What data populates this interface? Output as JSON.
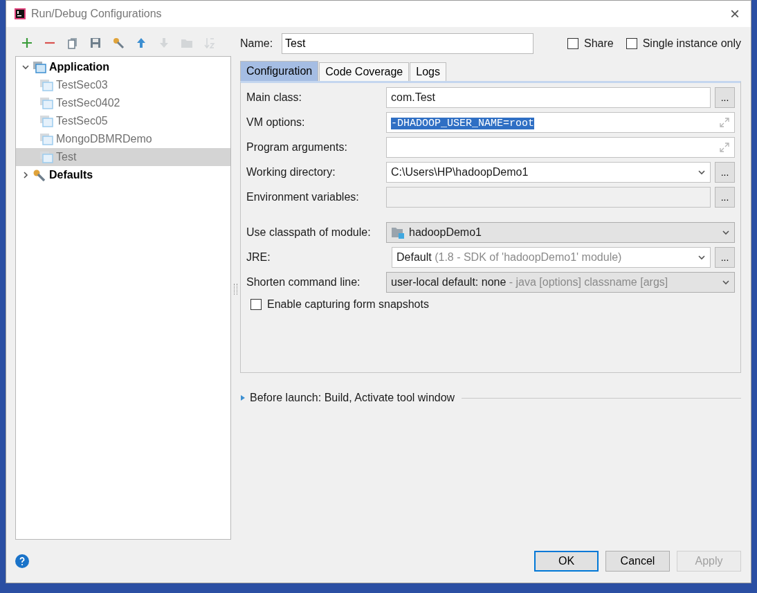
{
  "window": {
    "title": "Run/Debug Configurations",
    "close": "×"
  },
  "toolbar": [
    {
      "kind": "add",
      "disabled": false
    },
    {
      "kind": "remove",
      "disabled": false
    },
    {
      "kind": "copy",
      "disabled": false
    },
    {
      "kind": "save",
      "disabled": false
    },
    {
      "kind": "wrench",
      "disabled": false
    },
    {
      "kind": "up",
      "disabled": false
    },
    {
      "kind": "down",
      "disabled": true
    },
    {
      "kind": "folder",
      "disabled": true
    },
    {
      "kind": "sort",
      "disabled": true
    }
  ],
  "tree": [
    {
      "label": "Application",
      "kind": "group",
      "expanded": true,
      "selected": false,
      "children": [
        {
          "label": "TestSec03",
          "kind": "config",
          "selected": false
        },
        {
          "label": "TestSec0402",
          "kind": "config",
          "selected": false
        },
        {
          "label": "TestSec05",
          "kind": "config",
          "selected": false
        },
        {
          "label": "MongoDBMRDemo",
          "kind": "config",
          "selected": false
        },
        {
          "label": "Test",
          "kind": "config",
          "selected": true
        }
      ]
    },
    {
      "label": "Defaults",
      "kind": "defaults",
      "expanded": false,
      "selected": false
    }
  ],
  "name": {
    "label": "Name:",
    "value": "Test"
  },
  "options": [
    {
      "label": "Share",
      "checked": false
    },
    {
      "label": "Single instance only",
      "checked": false
    }
  ],
  "tabs": [
    {
      "label": "Configuration",
      "selected": true
    },
    {
      "label": "Code Coverage",
      "selected": false
    },
    {
      "label": "Logs",
      "selected": false
    }
  ],
  "fields": [
    {
      "kind": "text",
      "label": "Main class:",
      "value": "com.Test",
      "browse": "..."
    },
    {
      "kind": "expandable",
      "label": "VM options:",
      "value": "-DHADOOP_USER_NAME=root",
      "text_selected": true
    },
    {
      "kind": "expandable",
      "label": "Program arguments:"
    },
    {
      "kind": "combo",
      "label": "Working directory:",
      "value": "C:\\Users\\HP\\hadoopDemo1",
      "browse": "..."
    },
    {
      "kind": "readonly",
      "label": "Environment variables:",
      "browse": "..."
    },
    {
      "kind": "module",
      "label": "Use classpath of module:",
      "value": "hadoopDemo1"
    },
    {
      "kind": "jre",
      "label": "JRE:",
      "value": "Default",
      "hint": "(1.8 - SDK of 'hadoopDemo1' module)",
      "browse": "..."
    },
    {
      "kind": "select",
      "label": "Shorten command line:",
      "value": "user-local default: none",
      "hint": "- java [options] classname [args]"
    }
  ],
  "snapshot": {
    "label": "Enable capturing form snapshots",
    "checked": false
  },
  "before_launch": {
    "label": "Before launch: Build, Activate tool window",
    "expanded": false
  },
  "buttons": [
    {
      "label": "OK",
      "kind": "default",
      "disabled": false
    },
    {
      "label": "Cancel",
      "kind": "normal",
      "disabled": false
    },
    {
      "label": "Apply",
      "kind": "normal",
      "disabled": true
    }
  ]
}
